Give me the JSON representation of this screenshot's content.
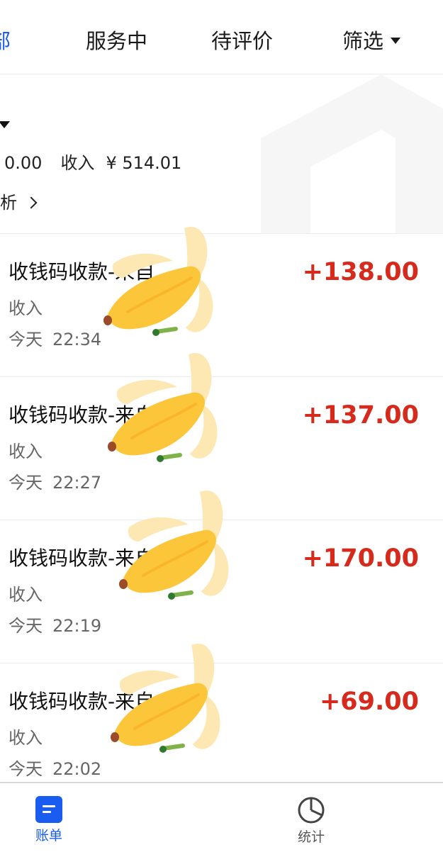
{
  "tabs": {
    "all": "部",
    "serving": "服务中",
    "pending_review": "待评价",
    "filter": "筛选"
  },
  "summary": {
    "expense_amount": "0.00",
    "income_label": "收入",
    "income_amount": "¥ 514.01",
    "analysis_label": "析"
  },
  "transactions": [
    {
      "title": "收钱码收款-来自",
      "type": "收入",
      "date": "今天",
      "time": "22:34",
      "amount": "+138.00"
    },
    {
      "title": "收钱码收款-来自",
      "type": "收入",
      "date": "今天",
      "time": "22:27",
      "amount": "+137.00"
    },
    {
      "title": "收钱码收款-来自",
      "type": "收入",
      "date": "今天",
      "time": "22:19",
      "amount": "+170.00"
    },
    {
      "title": "收钱码收款-来自",
      "type": "收入",
      "date": "今天",
      "time": "22:02",
      "amount": "+69.00"
    }
  ],
  "bottom_nav": {
    "bills": "账单",
    "stats": "统计"
  },
  "colors": {
    "accent_blue": "#1a5cf0",
    "amount_red": "#d52a1c",
    "banana_yellow": "#fcc63a",
    "banana_peel": "#fde7b2"
  },
  "icons": {
    "stats": "pie-chart-icon",
    "bills": "bill-icon",
    "sticker": "banana-sticker"
  }
}
